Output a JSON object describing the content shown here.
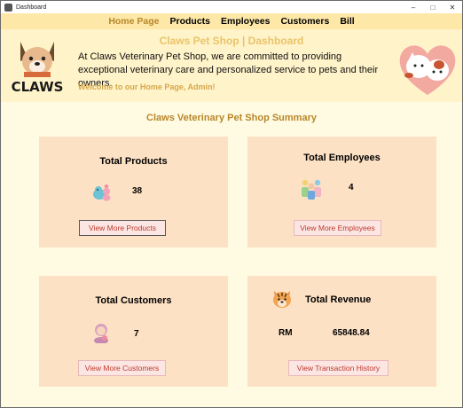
{
  "window": {
    "title": "Dashboard",
    "controls": [
      "–",
      "□",
      "✕"
    ]
  },
  "nav": {
    "items": [
      "Home Page",
      "Products",
      "Employees",
      "Customers",
      "Bill"
    ],
    "active": "Home Page"
  },
  "header": {
    "logo_text": "CLAWS",
    "title": "Claws Pet Shop | Dashboard",
    "description": "At Claws Veterinary Pet Shop, we are committed to providing exceptional veterinary care and personalized service to pets and their owners.",
    "welcome_text": "Welcome to our Home Page,",
    "user": "Admin!"
  },
  "summary": {
    "title": "Claws Veterinary Pet Shop Summary",
    "products": {
      "title": "Total Products",
      "value": "38",
      "button": "View More Products",
      "icon": "pets-icon"
    },
    "employees": {
      "title": "Total Employees",
      "value": "4",
      "button": "View More Employees",
      "icon": "employees-icon"
    },
    "customers": {
      "title": "Total Customers",
      "value": "7",
      "button": "View More Customers",
      "icon": "customer-icon"
    },
    "revenue": {
      "title": "Total Revenue",
      "currency": "RM",
      "value": "65848.84",
      "button": "View Transaction History",
      "icon": "tiger-icon"
    }
  },
  "colors": {
    "background": "#fffbe3",
    "navbar": "#fde8a8",
    "header": "#fff3c9",
    "card": "#fde1c4",
    "accent": "#b8862a",
    "button_text": "#c0392b"
  }
}
